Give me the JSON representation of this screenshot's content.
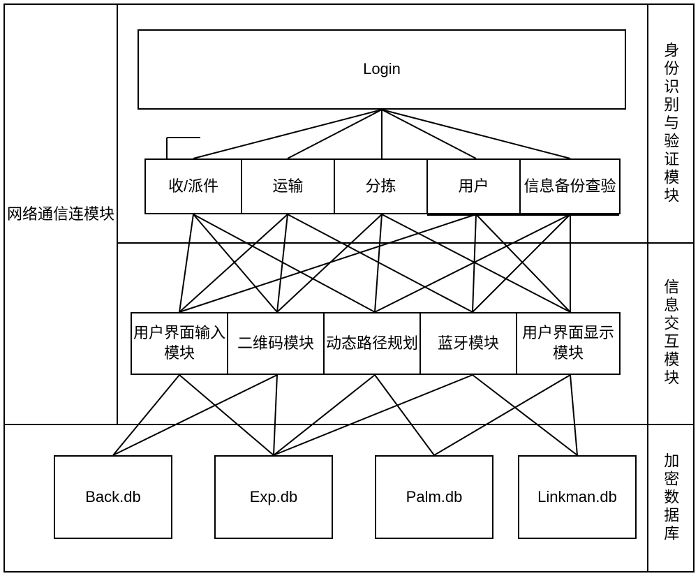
{
  "left_module": "网络通信连模块",
  "section1_label": "身份识别与验证模块",
  "login_label": "Login",
  "top_items": [
    "收/派件",
    "运输",
    "分拣",
    "用户",
    "信息备份查验"
  ],
  "section2_label": "信息交互模块",
  "mid_items": [
    "用户界面输入模块",
    "二维码模块",
    "动态路径规划",
    "蓝牙模块",
    "用户界面显示模块"
  ],
  "section3_label": "加密数据库",
  "db_items": [
    "Back.db",
    "Exp.db",
    "Palm.db",
    "Linkman.db"
  ]
}
